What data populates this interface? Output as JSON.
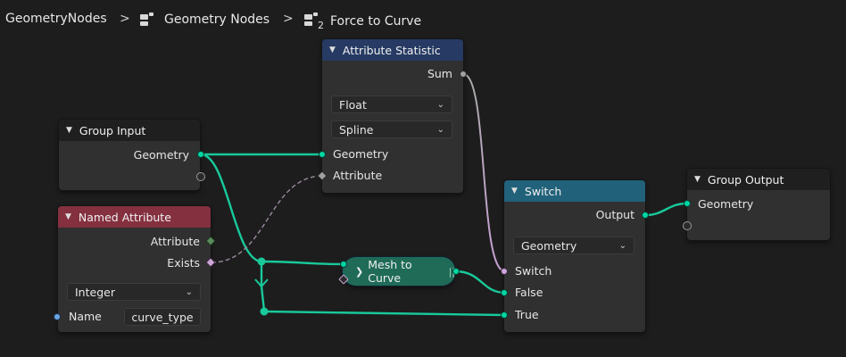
{
  "breadcrumb": {
    "items": [
      "GeometryNodes",
      "Geometry Nodes",
      "Force to Curve"
    ],
    "separator": ">",
    "subscript": "2"
  },
  "nodes": {
    "group_input": {
      "title": "Group Input",
      "outputs": [
        "Geometry"
      ]
    },
    "named_attribute": {
      "title": "Named Attribute",
      "outputs": [
        "Attribute",
        "Exists"
      ],
      "type_value": "Integer",
      "name_label": "Name",
      "name_value": "curve_type"
    },
    "attribute_statistic": {
      "title": "Attribute Statistic",
      "output_sum": "Sum",
      "type_value": "Float",
      "domain_value": "Spline",
      "inputs": [
        "Geometry",
        "Attribute"
      ]
    },
    "mesh_to_curve": {
      "title": "Mesh to Curve"
    },
    "switch": {
      "title": "Switch",
      "output": "Output",
      "type_value": "Geometry",
      "inputs": [
        "Switch",
        "False",
        "True"
      ]
    },
    "group_output": {
      "title": "Group Output",
      "inputs": [
        "Geometry"
      ]
    }
  },
  "colors": {
    "geometry_socket": "#00d6a3",
    "float_socket": "#a1a1a1",
    "boolean_socket": "#cca6d6",
    "integer_socket": "#598c5c",
    "string_socket": "#6ba6e6",
    "background": "#1d1d1d"
  }
}
